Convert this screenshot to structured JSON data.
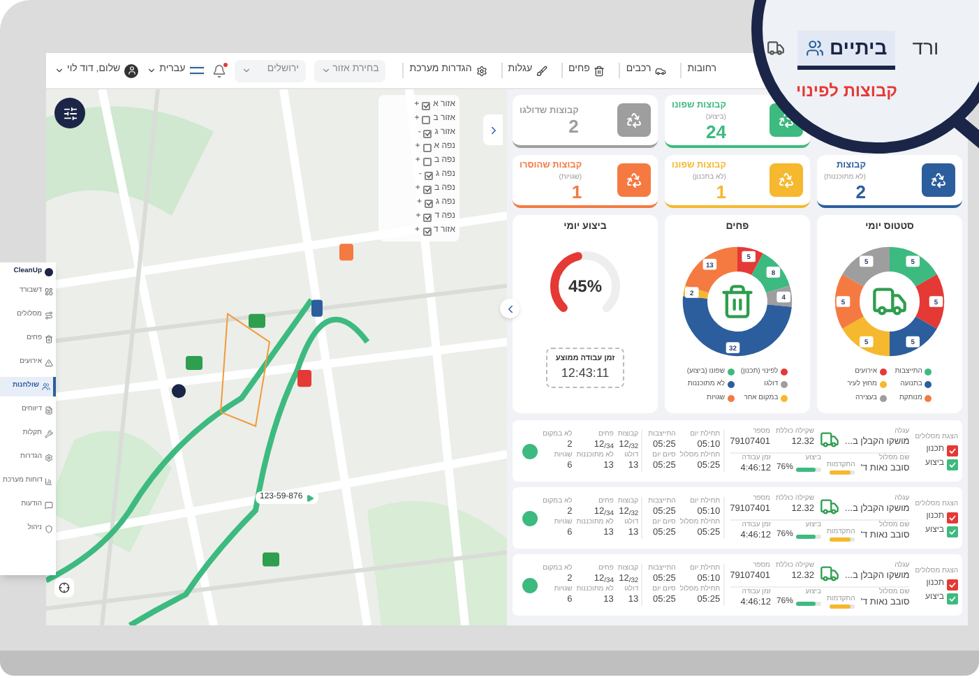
{
  "header": {
    "menu": [
      {
        "label": "רחובות"
      },
      {
        "label": "רכבים"
      },
      {
        "label": "פחים"
      },
      {
        "label": "עגלות"
      },
      {
        "label": "הגדרות מערכת"
      }
    ],
    "selects": [
      {
        "placeholder": "בחירת אזור"
      },
      {
        "placeholder": "ירושלים"
      }
    ],
    "notifications": {
      "unread": true
    },
    "language": "עברית",
    "user": "שלום, דוד לוי"
  },
  "map": {
    "layers": [
      {
        "sign": "+",
        "checked": true,
        "label": "אזור א"
      },
      {
        "sign": "+",
        "checked": false,
        "label": "אזור ב"
      },
      {
        "sign": "-",
        "checked": true,
        "label": "אזור ג"
      },
      {
        "sign": "+",
        "checked": false,
        "label": "נפה א"
      },
      {
        "sign": "+",
        "checked": false,
        "label": "נפה ב"
      },
      {
        "sign": "-",
        "checked": true,
        "label": "נפה ג"
      },
      {
        "sign": "+",
        "checked": true,
        "label": "נפה ב"
      },
      {
        "sign": "+",
        "checked": true,
        "label": "נפה ג"
      },
      {
        "sign": "+",
        "checked": true,
        "label": "נפה ד"
      },
      {
        "sign": "+",
        "checked": true,
        "label": "אזור ד"
      }
    ],
    "vehicle_tag": "123-59-876"
  },
  "stats": [
    {
      "title": "קבוצות שפונו",
      "subtitle": "(ביצוע)",
      "value": "24",
      "color": "#3dba7f"
    },
    {
      "title": "קבוצות שדולגו",
      "value": "2",
      "color": "#9e9e9e"
    },
    {
      "title": "קבוצות",
      "subtitle": "(לא מתוכננות)",
      "value": "2",
      "color": "#2c5e9e"
    },
    {
      "title": "קבוצות שפונו",
      "subtitle": "(לא בתכנון)",
      "value": "1",
      "color": "#f5b82e"
    },
    {
      "title": "קבוצות שהוסרו",
      "subtitle": "(שגויות)",
      "value": "1",
      "color": "#f47a42"
    }
  ],
  "donuts": [
    {
      "chart_data": {
        "type": "donut",
        "title": "סטטוס יומי",
        "values": [
          5,
          5,
          5,
          5,
          5,
          5
        ],
        "data_labels": true
      },
      "legend": [
        {
          "label": "התייצבות",
          "color": "#3dba7f"
        },
        {
          "label": "אירועים",
          "color": "#e53935"
        },
        {
          "label": "בתנועה",
          "color": "#2c5e9e"
        },
        {
          "label": "מחוץ לעיר",
          "color": "#f5b82e"
        },
        {
          "label": "מנותקת",
          "color": "#f47a42"
        },
        {
          "label": "בעצירה",
          "color": "#9e9e9e"
        }
      ]
    },
    {
      "chart_data": {
        "type": "donut",
        "title": "פחים",
        "values": [
          5,
          8,
          4,
          32,
          2,
          13
        ],
        "data_labels": true
      },
      "legend": [
        {
          "label": "לפינוי (תכנון)",
          "color": "#e53935"
        },
        {
          "label": "שפונו (ביצוע)",
          "color": "#3dba7f"
        },
        {
          "label": "דולגו",
          "color": "#9e9e9e"
        },
        {
          "label": "לא מתוכננות",
          "color": "#2c5e9e"
        },
        {
          "label": "במקום אחר",
          "color": "#f5b82e"
        },
        {
          "label": "שגויות",
          "color": "#f47a42"
        }
      ]
    }
  ],
  "daily": {
    "title": "ביצוע יומי",
    "level": 0.45,
    "reading": "45%",
    "avg_label": "זמן עבודה ממוצע",
    "avg_value": "12:43:11"
  },
  "routes": [
    {
      "show_label": "הצגת מסלולים",
      "toggles": [
        {
          "label": "תכנון",
          "checked": true,
          "color": "#e53935"
        },
        {
          "label": "ביצוע",
          "checked": true,
          "color": "#3dba7f"
        }
      ],
      "vehicle": {
        "label": "עגלה",
        "value": "מושקו הקבלן ב..."
      },
      "weight": {
        "label": "שקילה כוללת",
        "value": "12.32"
      },
      "number": {
        "label": "מספר",
        "value": "79107401"
      },
      "route": {
        "label": "שם מסלול",
        "value": "סובב נאות ד'"
      },
      "progress": {
        "label": "התקדמות",
        "level": 0.8
      },
      "performance": {
        "label": "ביצוע",
        "level": 0.76,
        "reading": "76%"
      },
      "work_time": {
        "label": "זמן עבודה",
        "value": "4:46:12"
      },
      "times": [
        {
          "label": "תחילת יום",
          "value": "05:10"
        },
        {
          "label": "התייצבות",
          "value": "05:25"
        },
        {
          "label": "תחילת מסלול",
          "value": "05:25"
        },
        {
          "label": "סיום יום",
          "value": "05:25"
        }
      ],
      "counts": [
        {
          "label": "קבוצות",
          "value": "12$_{/32}$"
        },
        {
          "label": "פחים",
          "value": "12$_{/34}$"
        },
        {
          "label": "לא במקום",
          "value": "2"
        },
        {
          "label": "דולגו",
          "value": "13"
        },
        {
          "label": "לא מתוכננות",
          "value": "13"
        },
        {
          "label": "שגויות",
          "value": "6"
        }
      ]
    },
    {
      "show_label": "הצגת מסלולים",
      "toggles": [
        {
          "label": "תכנון",
          "checked": true,
          "color": "#e53935"
        },
        {
          "label": "ביצוע",
          "checked": true,
          "color": "#3dba7f"
        }
      ],
      "vehicle": {
        "label": "עגלה",
        "value": "מושקו הקבלן ב..."
      },
      "weight": {
        "label": "שקילה כוללת",
        "value": "12.32"
      },
      "number": {
        "label": "מספר",
        "value": "79107401"
      },
      "route": {
        "label": "שם מסלול",
        "value": "סובב נאות ד'"
      },
      "progress": {
        "label": "התקדמות",
        "level": 0.8
      },
      "performance": {
        "label": "ביצוע",
        "level": 0.76,
        "reading": "76%"
      },
      "work_time": {
        "label": "זמן עבודה",
        "value": "4:46:12"
      },
      "times": [
        {
          "label": "תחילת יום",
          "value": "05:10"
        },
        {
          "label": "התייצבות",
          "value": "05:25"
        },
        {
          "label": "תחילת מסלול",
          "value": "05:25"
        },
        {
          "label": "סיום יום",
          "value": "05:25"
        }
      ],
      "counts": [
        {
          "label": "קבוצות",
          "value": "12$_{/32}$"
        },
        {
          "label": "פחים",
          "value": "12$_{/34}$"
        },
        {
          "label": "לא במקום",
          "value": "2"
        },
        {
          "label": "דולגו",
          "value": "13"
        },
        {
          "label": "לא מתוכננות",
          "value": "13"
        },
        {
          "label": "שגויות",
          "value": "6"
        }
      ]
    },
    {
      "show_label": "הצגת מסלולים",
      "toggles": [
        {
          "label": "תכנון",
          "checked": true,
          "color": "#e53935"
        },
        {
          "label": "ביצוע",
          "checked": true,
          "color": "#3dba7f"
        }
      ],
      "vehicle": {
        "label": "עגלה",
        "value": "מושקו הקבלן ב..."
      },
      "weight": {
        "label": "שקילה כוללת",
        "value": "12.32"
      },
      "number": {
        "label": "מספר",
        "value": "79107401"
      },
      "route": {
        "label": "שם מסלול",
        "value": "סובב נאות ד'"
      },
      "progress": {
        "label": "התקדמות",
        "level": 0.8
      },
      "performance": {
        "label": "ביצוע",
        "level": 0.76,
        "reading": "76%"
      },
      "work_time": {
        "label": "זמן עבודה",
        "value": "4:46:12"
      },
      "times": [
        {
          "label": "תחילת יום",
          "value": "05:10"
        },
        {
          "label": "התייצבות",
          "value": "05:25"
        },
        {
          "label": "תחילת מסלול",
          "value": "05:25"
        },
        {
          "label": "סיום יום",
          "value": "05:25"
        }
      ],
      "counts": [
        {
          "label": "קבוצות",
          "value": "12$_{/32}$"
        },
        {
          "label": "פחים",
          "value": "12$_{/34}$"
        },
        {
          "label": "לא במקום",
          "value": "2"
        },
        {
          "label": "דולגו",
          "value": "13"
        },
        {
          "label": "לא מתוכננות",
          "value": "13"
        },
        {
          "label": "שגויות",
          "value": "6"
        }
      ]
    }
  ],
  "sidebar": {
    "logo": "CleanUp",
    "items": [
      {
        "label": "דשבורד",
        "selected": false
      },
      {
        "label": "מסלולים",
        "selected": false
      },
      {
        "label": "פחים",
        "selected": false
      },
      {
        "label": "אירועים",
        "selected": false
      },
      {
        "label": "שולחנות",
        "selected": true
      },
      {
        "label": "דיווחים",
        "selected": false
      },
      {
        "label": "תקלות",
        "selected": false
      },
      {
        "label": "הגדרות",
        "selected": false
      },
      {
        "label": "דוחות מערכת",
        "selected": false
      },
      {
        "label": "הודעות",
        "selected": false
      },
      {
        "label": "ניהול",
        "selected": false
      }
    ]
  },
  "magnifier": {
    "tabs": [
      {
        "kind": "text",
        "label": "ורד",
        "selected": false
      },
      {
        "kind": "text",
        "label": "ביתיים",
        "selected": true
      },
      {
        "kind": "icon",
        "selected": false
      }
    ],
    "heading": "קבוצות לפינוי"
  }
}
